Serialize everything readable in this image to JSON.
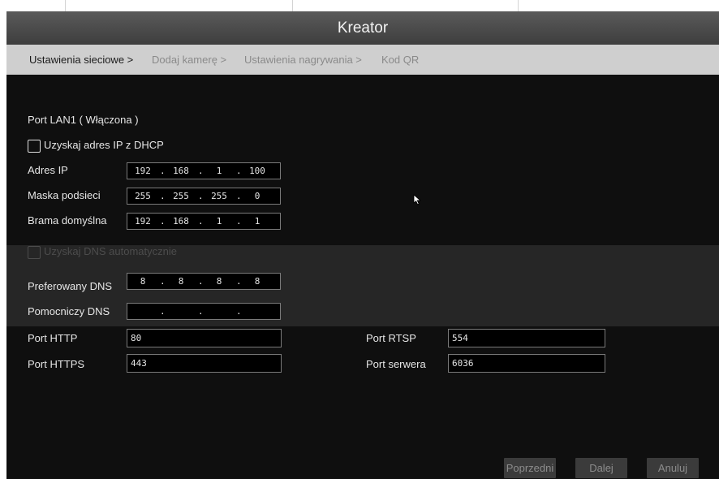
{
  "window": {
    "title": "Kreator"
  },
  "steps": [
    {
      "label": "Ustawienia sieciowe >",
      "active": true
    },
    {
      "label": "Dodaj kamerę >",
      "active": false
    },
    {
      "label": "Ustawienia nagrywania >",
      "active": false
    },
    {
      "label": "Kod QR",
      "active": false
    }
  ],
  "port_section": {
    "title": "Port LAN1 ( Włączona )"
  },
  "dhcp": {
    "label": "Uzyskaj adres IP z DHCP",
    "checked": false
  },
  "ip": {
    "label": "Adres IP",
    "octets": [
      "192",
      "168",
      "1",
      "100"
    ],
    "separator": "."
  },
  "mask": {
    "label": "Maska podsieci",
    "octets": [
      "255",
      "255",
      "255",
      "0"
    ],
    "separator": "."
  },
  "gateway": {
    "label": "Brama domyślna",
    "octets": [
      "192",
      "168",
      "1",
      "1"
    ],
    "separator": "."
  },
  "dns_auto": {
    "label": "Uzyskaj DNS automatycznie",
    "checked": false,
    "enabled": false
  },
  "dns_pref": {
    "label": "Preferowany DNS",
    "octets": [
      "8",
      "8",
      "8",
      "8"
    ],
    "separator": "."
  },
  "dns_alt": {
    "label": "Pomocniczy DNS",
    "octets": [
      "",
      "",
      "",
      ""
    ],
    "separator": "."
  },
  "ports": {
    "http": {
      "label": "Port HTTP",
      "value": "80"
    },
    "https": {
      "label": "Port HTTPS",
      "value": "443"
    },
    "rtsp": {
      "label": "Port RTSP",
      "value": "554"
    },
    "server": {
      "label": "Port serwera",
      "value": "6036"
    }
  },
  "buttons": {
    "prev": "Poprzedni",
    "next": "Dalej",
    "cancel": "Anuluj"
  },
  "colors": {
    "background": "#0f0f0f",
    "titlebar": "#4a4a4a",
    "stepbar": "#cfcfcf"
  }
}
